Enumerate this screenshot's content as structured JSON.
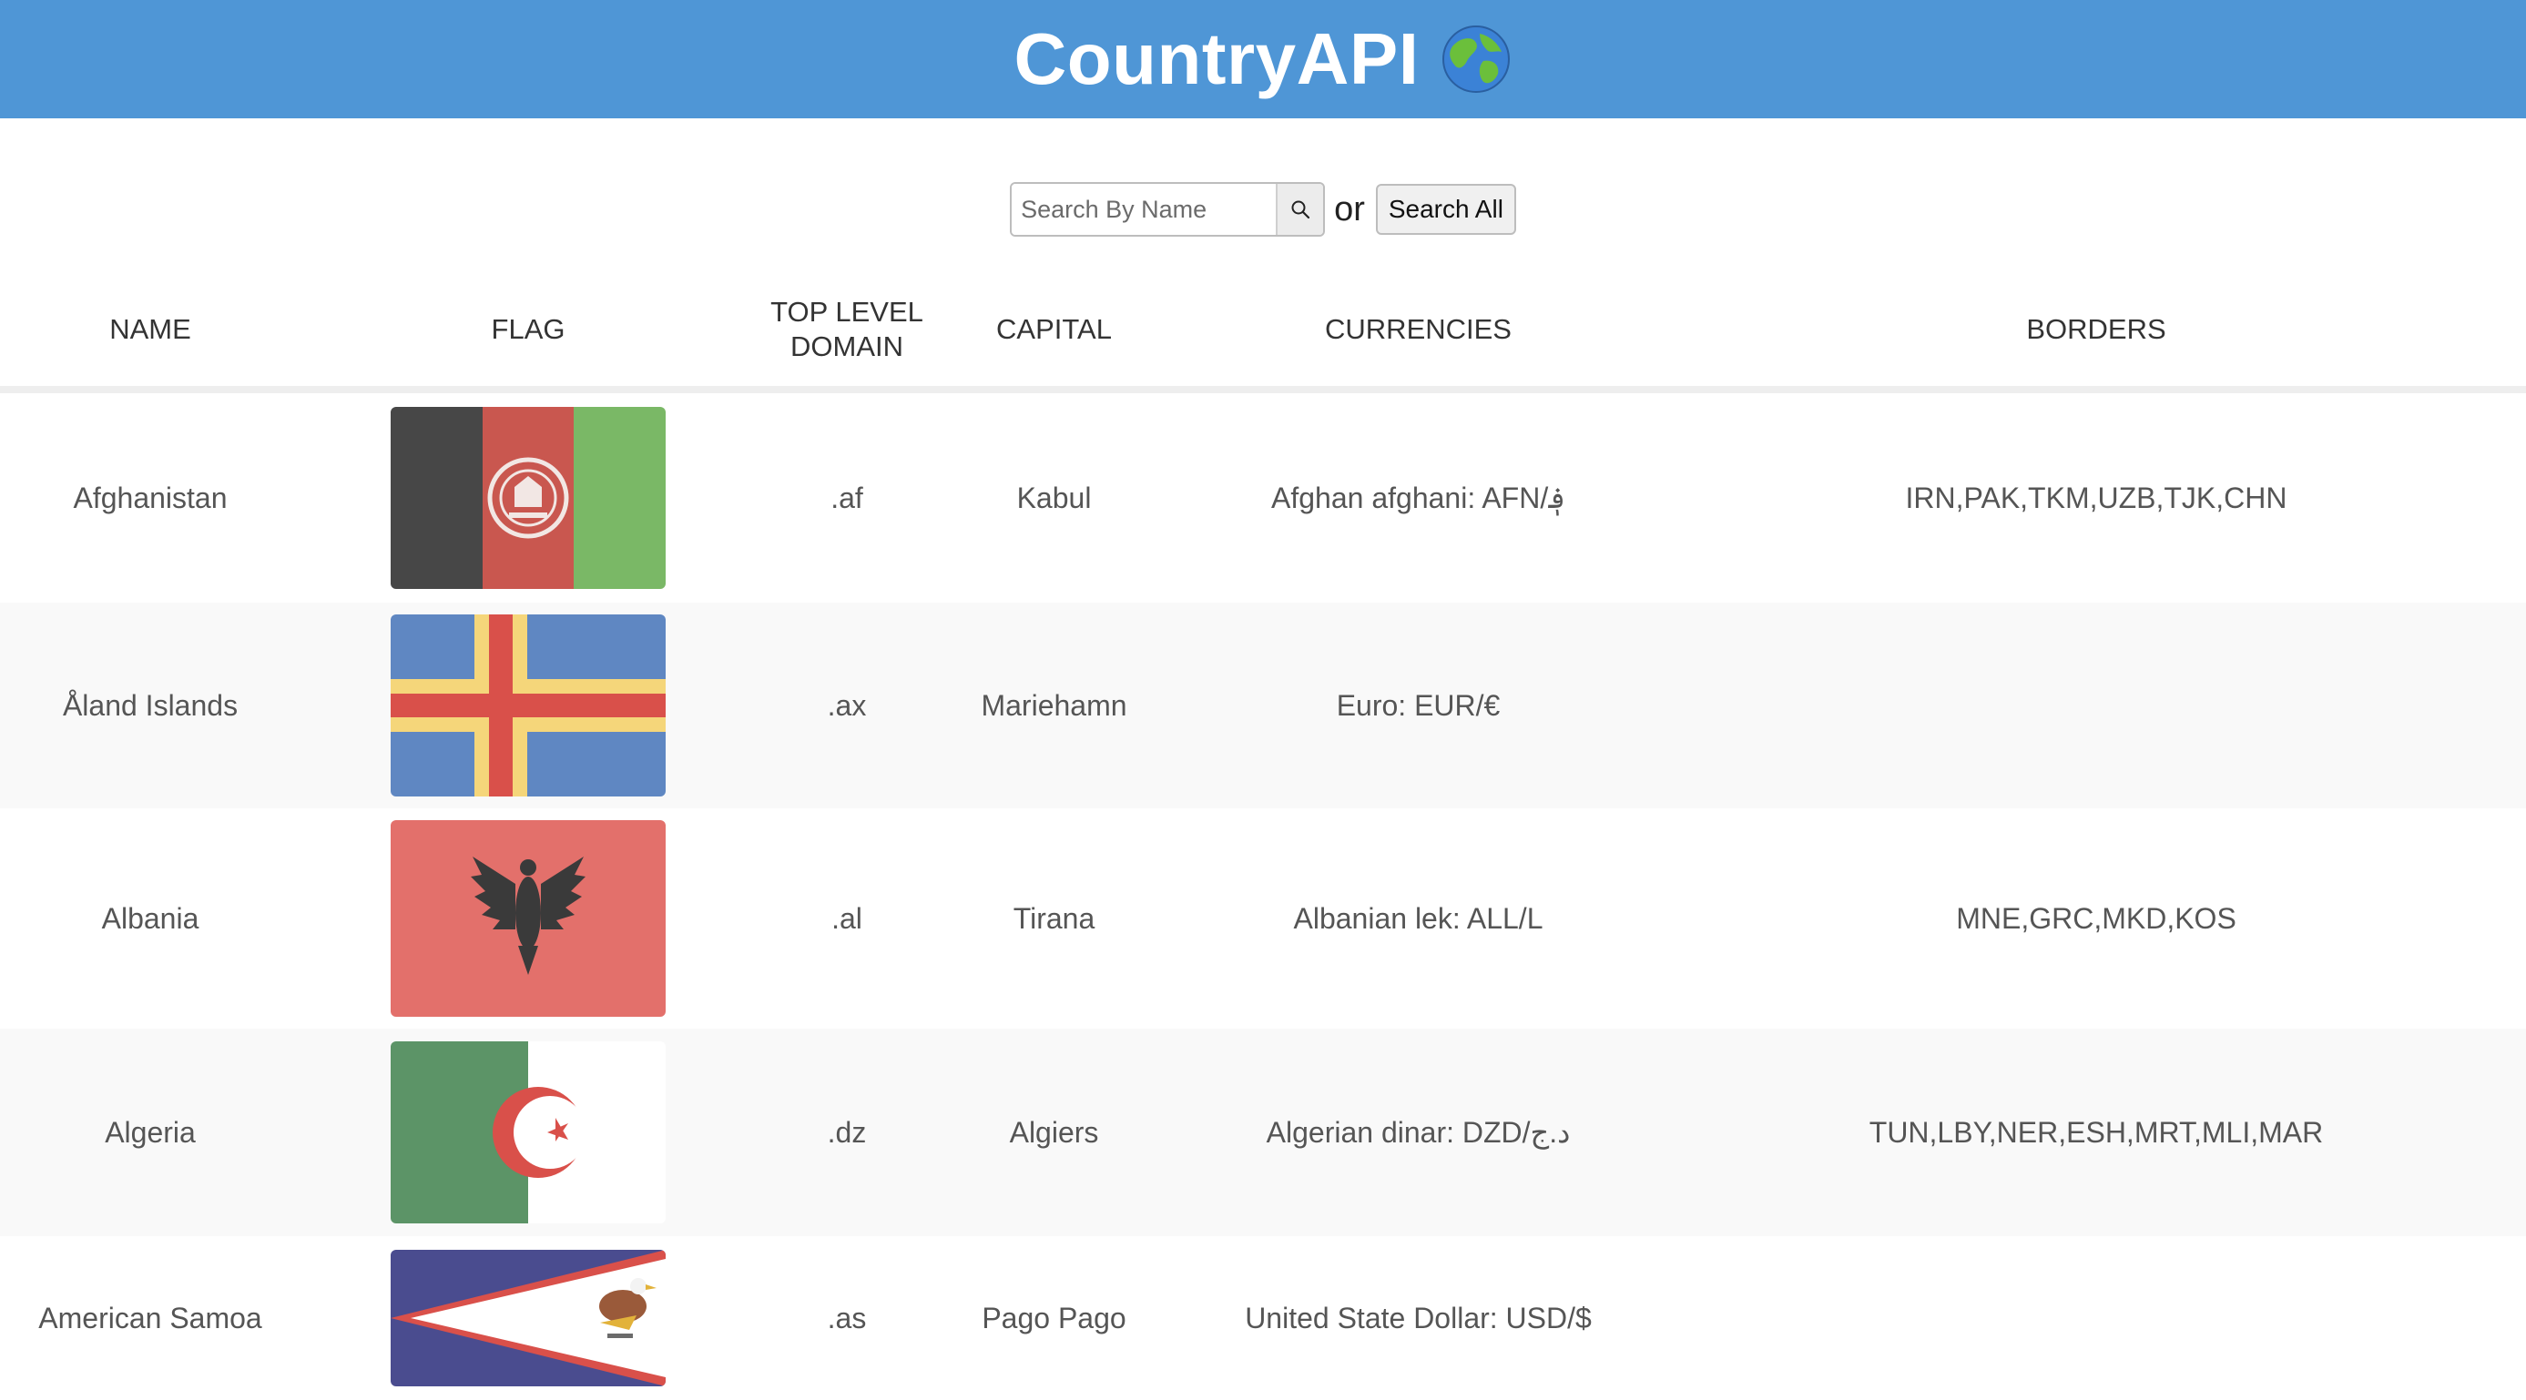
{
  "header": {
    "title": "CountryAPI",
    "icon": "globe-icon"
  },
  "search": {
    "placeholder": "Search By Name",
    "value": "",
    "or_label": "or",
    "search_all_label": "Search All",
    "icon": "search-icon"
  },
  "table": {
    "headers": [
      "NAME",
      "FLAG",
      "TOP LEVEL DOMAIN",
      "CAPITAL",
      "CURRENCIES",
      "BORDERS"
    ],
    "rows": [
      {
        "name": "Afghanistan",
        "flag": "afghanistan-flag",
        "tld": ".af",
        "capital": "Kabul",
        "currencies": "Afghan afghani: AFN/؋",
        "borders": "IRN,PAK,TKM,UZB,TJK,CHN"
      },
      {
        "name": "Åland Islands",
        "flag": "aland-flag",
        "tld": ".ax",
        "capital": "Mariehamn",
        "currencies": "Euro: EUR/€",
        "borders": ""
      },
      {
        "name": "Albania",
        "flag": "albania-flag",
        "tld": ".al",
        "capital": "Tirana",
        "currencies": "Albanian lek: ALL/L",
        "borders": "MNE,GRC,MKD,KOS"
      },
      {
        "name": "Algeria",
        "flag": "algeria-flag",
        "tld": ".dz",
        "capital": "Algiers",
        "currencies": "Algerian dinar: DZD/د.ج",
        "borders": "TUN,LBY,NER,ESH,MRT,MLI,MAR"
      },
      {
        "name": "American Samoa",
        "flag": "american-samoa-flag",
        "tld": ".as",
        "capital": "Pago Pago",
        "currencies": "United State Dollar: USD/$",
        "borders": ""
      }
    ]
  },
  "colors": {
    "header_bg": "#4f96d6",
    "row_alt_bg": "#f9f9f9"
  }
}
